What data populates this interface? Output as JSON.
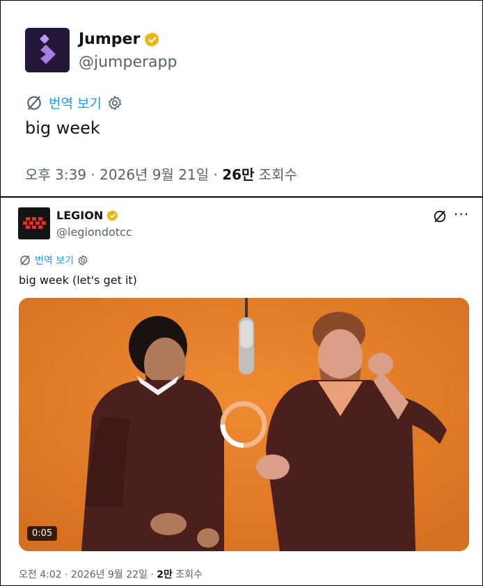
{
  "tweet1": {
    "name": "Jumper",
    "handle": "@jumperapp",
    "translate_label": "번역 보기",
    "text": "big week",
    "meta_prefix": "오후 3:39 · 2026년 9월 21일 · ",
    "views_count": "26만",
    "views_label": " 조회수"
  },
  "tweet2": {
    "name": "LEGION",
    "handle": "@legiondotcc",
    "translate_label": "번역 보기",
    "text": "big week (let's get it)",
    "video_time": "0:05",
    "meta_prefix": "오전 4:02 · 2026년 9월 22일 · ",
    "views_count": "2만",
    "views_label": " 조회수"
  },
  "colors": {
    "link": "#1d9bf0",
    "verified": "#e8b512",
    "muted": "#536471",
    "video_bg": "#e57f2a"
  },
  "icons": [
    "jumper-logo-icon",
    "verified-badge-icon",
    "translate-icon",
    "gear-icon",
    "legion-logo-icon",
    "more-options-icon",
    "loading-spinner-icon"
  ]
}
